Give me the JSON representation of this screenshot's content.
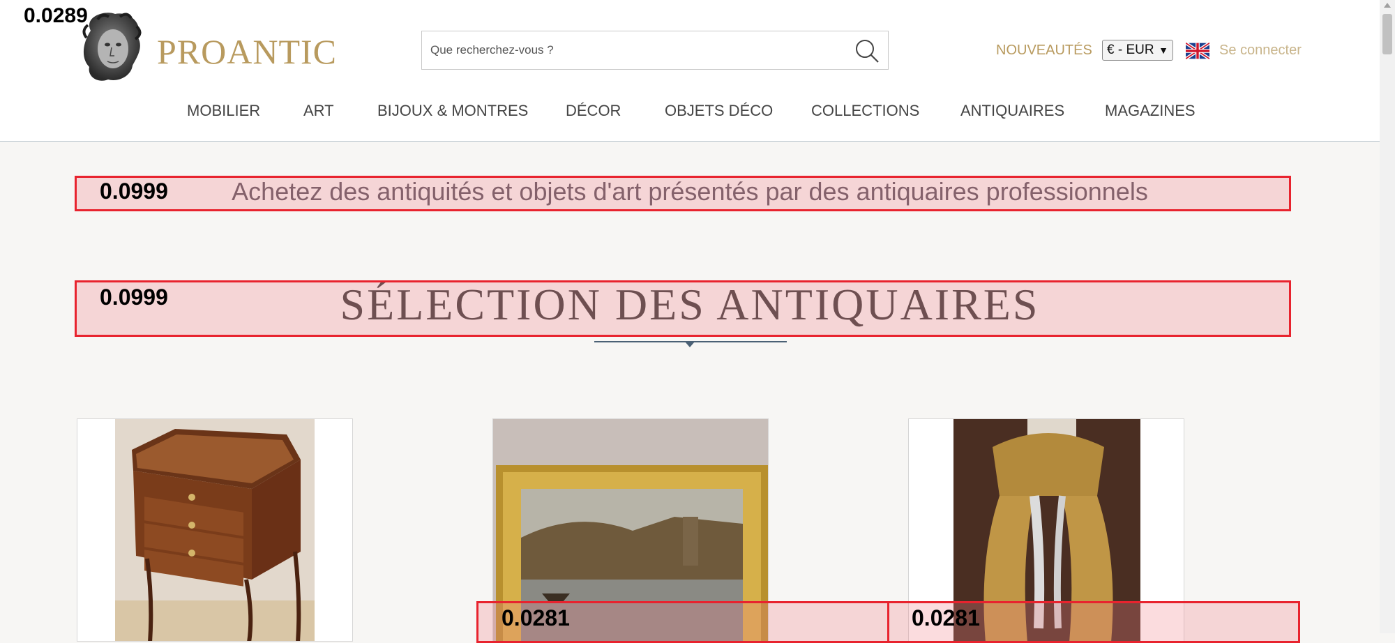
{
  "header": {
    "logo_text": "PROANTIC",
    "search_placeholder": "Que recherchez-vous ?",
    "new_label": "NOUVEAUTÉS",
    "currency": "€ - EUR",
    "login_label": "Se connecter"
  },
  "nav": {
    "items": [
      "MOBILIER",
      "ART",
      "BIJOUX & MONTRES",
      "DÉCOR",
      "OBJETS DÉCO",
      "COLLECTIONS",
      "ANTIQUAIRES",
      "MAGAZINES"
    ]
  },
  "main": {
    "tagline": "Achetez des antiquités et objets d'art présentés par des antiquaires professionnels",
    "section_title": "SÉLECTION DES ANTIQUAIRES"
  },
  "overlays": {
    "corner_score": "0.0289",
    "tagline_score": "0.0999",
    "title_score": "0.0999",
    "card2_score": "0.0281",
    "card3_score": "0.0281"
  },
  "colors": {
    "brand_gold": "#b89a5e",
    "overlay_red": "#e8232e",
    "background": "#f7f6f4"
  }
}
